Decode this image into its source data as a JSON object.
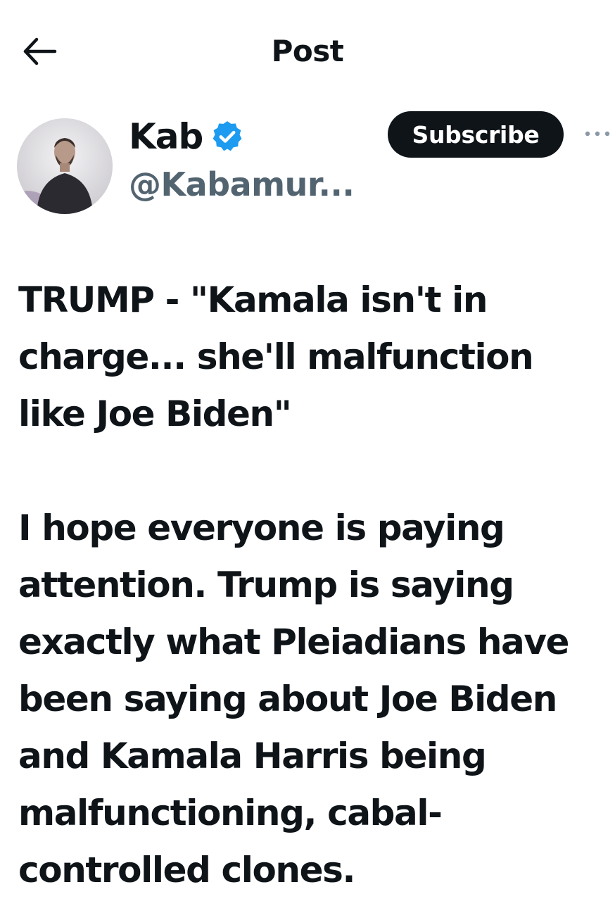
{
  "header": {
    "title": "Post",
    "back_icon": "arrow-left-icon"
  },
  "author": {
    "display_name": "Kab",
    "handle": "@Kabamur...",
    "verified_icon": "verified-badge-icon",
    "verified_color": "#1d9bf0",
    "subscribe_label": "Subscribe",
    "more_icon": "more-horizontal-icon"
  },
  "post": {
    "text": "TRUMP - \"Kamala isn't in charge... she'll malfunction like Joe Biden\"\n\nI hope everyone is paying attention. Trump is saying exactly what Pleiadians have been saying about Joe Biden and Kamala Harris being malfunctioning, cabal-controlled clones."
  },
  "colors": {
    "text_primary": "#0f1419",
    "text_secondary": "#536471",
    "button_bg": "#0f1419",
    "button_text": "#ffffff"
  }
}
